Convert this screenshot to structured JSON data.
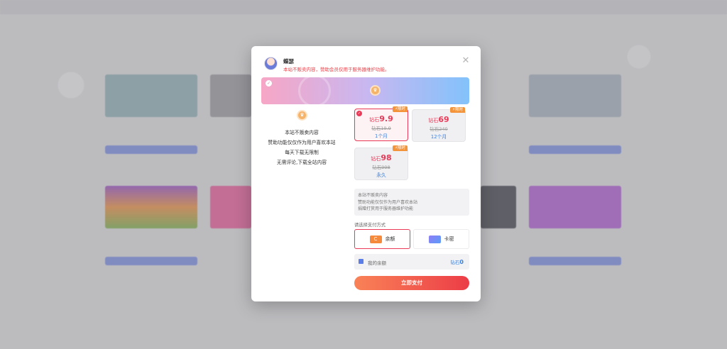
{
  "modal": {
    "username": "蝶瑟",
    "notice": "本站不贩卖内容，赞助会员仅用于服务器维护功能。",
    "close_glyph": "✕"
  },
  "info": {
    "badge_glyph": "♛",
    "lines": [
      "本站不贩卖内容",
      "赞助功能仅仅作为用户喜欢本站",
      "每天下载无限制",
      "无需评论,下载全站内容"
    ]
  },
  "plans": [
    {
      "tag": "限时",
      "currency": "钻石",
      "price": "9.9",
      "original": "钻石19.9",
      "period": "1个月",
      "selected": true
    },
    {
      "tag": "限时",
      "currency": "钻石",
      "price": "69",
      "original": "钻石240",
      "period": "12个月",
      "selected": false
    },
    {
      "tag": "限时",
      "currency": "钻石",
      "price": "98",
      "original": "钻石998",
      "period": "永久",
      "selected": false
    }
  ],
  "description": [
    "本站不贩卖内容",
    "赞助功能仅仅作为用户喜欢本站",
    "捐赠打赏用于服务器维护功能"
  ],
  "payment": {
    "label": "请选择支付方式",
    "balance_option": "余额",
    "card_option": "卡密",
    "my_balance_label": "我的余额",
    "balance_currency": "钻石",
    "balance_value": "0",
    "submit": "立即支付"
  },
  "colors": {
    "accent": "#ea3a58",
    "link": "#3b82e0",
    "button_gradient_start": "#f98257",
    "button_gradient_end": "#ec3d47"
  }
}
